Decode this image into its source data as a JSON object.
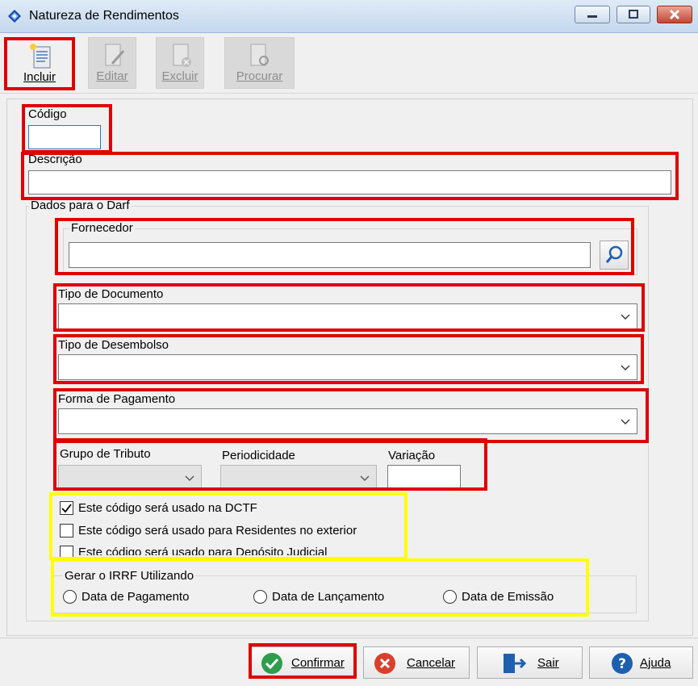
{
  "window": {
    "title": "Natureza de Rendimentos"
  },
  "toolbar": {
    "incluir": "Incluir",
    "editar": "Editar",
    "excluir": "Excluir",
    "procurar": "Procurar"
  },
  "form": {
    "codigo_label": "Código",
    "codigo_value": "",
    "descricao_label": "Descrição",
    "descricao_value": "",
    "darf_group": "Dados para o Darf",
    "fornecedor_label": "Fornecedor",
    "fornecedor_value": "",
    "tipo_documento_label": "Tipo de Documento",
    "tipo_documento_value": "",
    "tipo_desembolso_label": "Tipo de Desembolso",
    "tipo_desembolso_value": "",
    "forma_pagamento_label": "Forma de Pagamento",
    "forma_pagamento_value": "",
    "grupo_tributo_label": "Grupo de Tributo",
    "periodicidade_label": "Periodicidade",
    "variacao_label": "Variação",
    "variacao_value": ""
  },
  "checkboxes": [
    {
      "label": "Este código será usado na DCTF",
      "checked": true
    },
    {
      "label": "Este código será usado para Residentes no exterior",
      "checked": false
    },
    {
      "label": "Este código será usado para Depósito Judicial",
      "checked": false
    }
  ],
  "irrf": {
    "caption": "Gerar o IRRF Utilizando",
    "options": [
      "Data de Pagamento",
      "Data de Lançamento",
      "Data de Emissão"
    ]
  },
  "buttons": {
    "confirmar": "Confirmar",
    "cancelar": "Cancelar",
    "sair": "Sair",
    "ajuda": "Ajuda"
  },
  "colors": {
    "highlight_red": "#e00000",
    "highlight_yellow": "#ffff00",
    "focus_blue": "#1e7bd7"
  }
}
